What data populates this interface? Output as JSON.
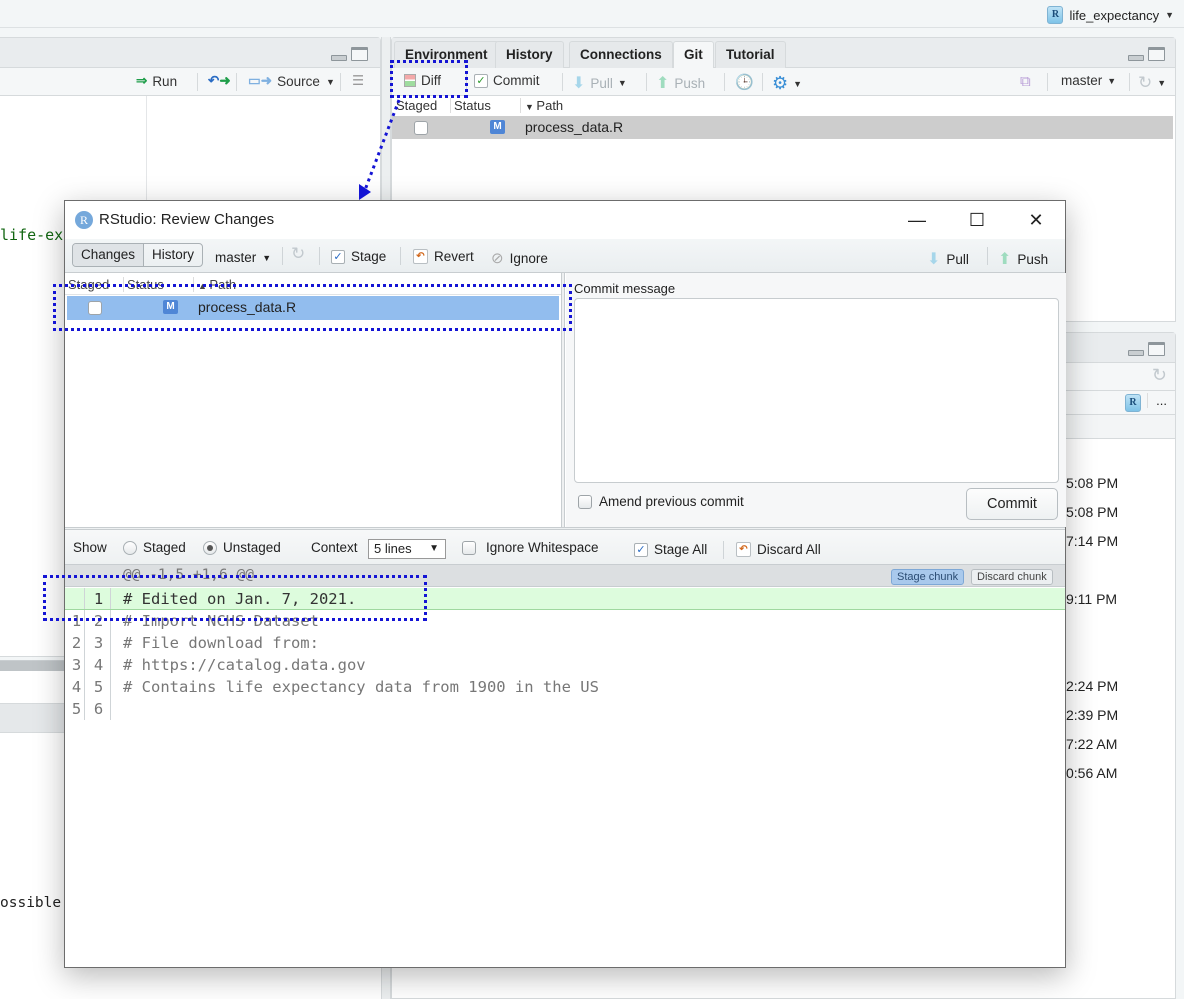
{
  "topbar": {
    "project_name": "life_expectancy",
    "project_icon": "r-project-icon"
  },
  "source_pane": {
    "toolbar": {
      "run_label": "Run",
      "rerun_icon": "re-run-icon",
      "source_label": "Source"
    },
    "code_fragment": "life-ex"
  },
  "console_pane": {
    "text_fragment": "ossible"
  },
  "git_pane": {
    "tabs": [
      "Environment",
      "History",
      "Connections",
      "Git",
      "Tutorial"
    ],
    "active_tab": "Git",
    "toolbar": {
      "diff_label": "Diff",
      "commit_label": "Commit",
      "pull_label": "Pull",
      "push_label": "Push",
      "branch": "master"
    },
    "columns": {
      "staged": "Staged",
      "status": "Status",
      "path": "Path"
    },
    "rows": [
      {
        "staged": false,
        "status": "M",
        "path": "process_data.R"
      }
    ]
  },
  "files_pane": {
    "times": [
      "5:08 PM",
      "5:08 PM",
      "7:14 PM",
      "9:11 PM",
      "2:24 PM",
      "2:39 PM",
      "7:22 AM",
      "0:56 AM"
    ],
    "more_label": "..."
  },
  "dialog": {
    "title": "RStudio: Review Changes",
    "toolbar": {
      "changes_label": "Changes",
      "history_label": "History",
      "branch": "master",
      "stage_label": "Stage",
      "revert_label": "Revert",
      "ignore_label": "Ignore",
      "pull_label": "Pull",
      "push_label": "Push"
    },
    "file_list": {
      "columns": {
        "staged": "Staged",
        "status": "Status",
        "path": "Path"
      },
      "rows": [
        {
          "staged": false,
          "status": "M",
          "path": "process_data.R",
          "selected": true
        }
      ]
    },
    "commit": {
      "message_label": "Commit message",
      "message_value": "",
      "amend_label": "Amend previous commit",
      "amend_checked": false,
      "commit_button": "Commit"
    },
    "diff_toolbar": {
      "show_label": "Show",
      "staged_label": "Staged",
      "unstaged_label": "Unstaged",
      "selected_view": "Unstaged",
      "context_label": "Context",
      "context_value": "5 lines",
      "ignore_ws_label": "Ignore Whitespace",
      "ignore_ws_checked": false,
      "stage_all_label": "Stage All",
      "discard_all_label": "Discard All"
    },
    "diff": {
      "hunk_header": "@@ -1,5 +1,6 @@",
      "stage_chunk_label": "Stage chunk",
      "discard_chunk_label": "Discard chunk",
      "lines": [
        {
          "old": "",
          "new": "1",
          "text": "# Edited on Jan. 7, 2021.",
          "type": "add"
        },
        {
          "old": "1",
          "new": "2",
          "text": "# Import NCHS Dataset",
          "type": "context"
        },
        {
          "old": "2",
          "new": "3",
          "text": "# File download from:",
          "type": "context"
        },
        {
          "old": "3",
          "new": "4",
          "text": "# https://catalog.data.gov",
          "type": "context"
        },
        {
          "old": "4",
          "new": "5",
          "text": "# Contains life expectancy data from 1900 in the US",
          "type": "context"
        },
        {
          "old": "5",
          "new": "6",
          "text": "",
          "type": "context"
        }
      ]
    }
  },
  "colors": {
    "annotation": "#1414d4",
    "selection": "#92bdee",
    "added_line": "#ddfcdd",
    "status_badge": "#4f86d6"
  }
}
